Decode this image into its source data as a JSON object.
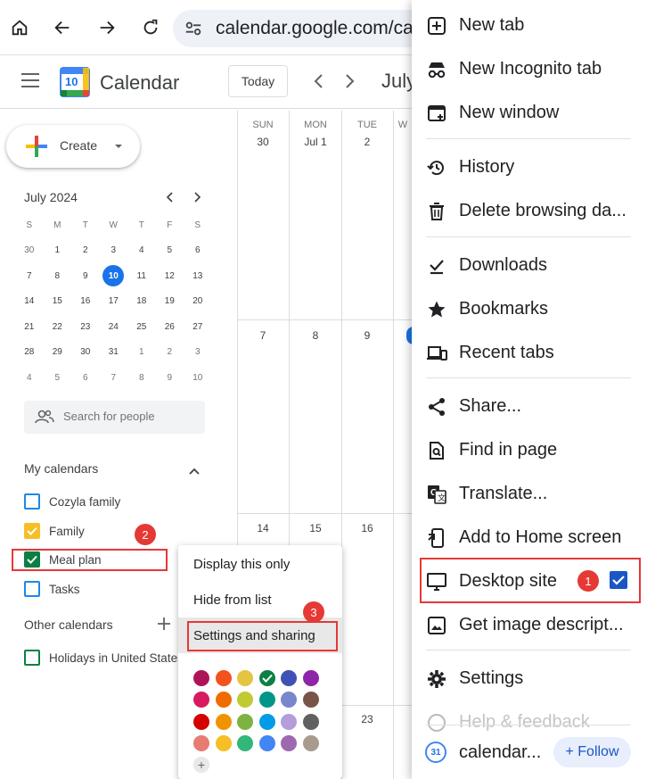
{
  "browser": {
    "url": "calendar.google.com/ca"
  },
  "header": {
    "app_title": "Calendar",
    "logo_day": "10",
    "today_label": "Today",
    "month_label": "July"
  },
  "sidebar": {
    "create_label": "Create",
    "mini_calendar": {
      "title": "July 2024",
      "weekdays": [
        "S",
        "M",
        "T",
        "W",
        "T",
        "F",
        "S"
      ],
      "weeks": [
        [
          "30",
          "1",
          "2",
          "3",
          "4",
          "5",
          "6"
        ],
        [
          "7",
          "8",
          "9",
          "10",
          "11",
          "12",
          "13"
        ],
        [
          "14",
          "15",
          "16",
          "17",
          "18",
          "19",
          "20"
        ],
        [
          "21",
          "22",
          "23",
          "24",
          "25",
          "26",
          "27"
        ],
        [
          "28",
          "29",
          "30",
          "31",
          "1",
          "2",
          "3"
        ],
        [
          "4",
          "5",
          "6",
          "7",
          "8",
          "9",
          "10"
        ]
      ]
    },
    "search_people_placeholder": "Search for people",
    "my_calendars_title": "My calendars",
    "my_calendars": [
      {
        "name": "Cozyla family",
        "color": "#1e88e5",
        "checked": false
      },
      {
        "name": "Family",
        "color": "#f6bf26",
        "checked": true
      },
      {
        "name": "Meal plan",
        "color": "#0b8043",
        "checked": true
      },
      {
        "name": "Tasks",
        "color": "#1e88e5",
        "checked": false
      }
    ],
    "other_calendars_title": "Other calendars",
    "other_calendars": [
      {
        "name": "Holidays in United States",
        "color": "#0b8043",
        "checked": false
      }
    ]
  },
  "grid": {
    "days": [
      {
        "name": "SUN",
        "date": "30"
      },
      {
        "name": "MON",
        "date": "Jul 1"
      },
      {
        "name": "TUE",
        "date": "2"
      },
      {
        "name": "W",
        "date": ""
      }
    ],
    "week2": [
      "7",
      "8",
      "9"
    ],
    "week3": [
      "14",
      "15",
      "16"
    ],
    "week4": [
      "23"
    ]
  },
  "context_menu": {
    "items": [
      "Display this only",
      "Hide from list",
      "Settings and sharing"
    ],
    "colors": [
      "#ad1457",
      "#f4511e",
      "#e4c441",
      "#0b8043",
      "#3f51b5",
      "#8e24aa",
      "#d81b60",
      "#ef6c00",
      "#c0ca33",
      "#009688",
      "#7986cb",
      "#795548",
      "#d50000",
      "#f09300",
      "#7cb342",
      "#039be5",
      "#b39ddb",
      "#616161",
      "#e67c73",
      "#f6bf26",
      "#33b679",
      "#4285f4",
      "#9e69af",
      "#a79b8e"
    ]
  },
  "chrome_menu": {
    "items": [
      {
        "label": "New tab",
        "icon": "plus-box-icon"
      },
      {
        "label": "New Incognito tab",
        "icon": "incognito-icon"
      },
      {
        "label": "New window",
        "icon": "new-window-icon"
      },
      {
        "label": "History",
        "icon": "history-icon"
      },
      {
        "label": "Delete browsing da...",
        "icon": "trash-icon"
      },
      {
        "label": "Downloads",
        "icon": "download-icon"
      },
      {
        "label": "Bookmarks",
        "icon": "star-icon"
      },
      {
        "label": "Recent tabs",
        "icon": "devices-icon"
      },
      {
        "label": "Share...",
        "icon": "share-icon"
      },
      {
        "label": "Find in page",
        "icon": "find-icon"
      },
      {
        "label": "Translate...",
        "icon": "translate-icon"
      },
      {
        "label": "Add to Home screen",
        "icon": "add-home-icon"
      },
      {
        "label": "Desktop site",
        "icon": "monitor-icon",
        "checked": true
      },
      {
        "label": "Get image descript...",
        "icon": "image-icon"
      },
      {
        "label": "Settings",
        "icon": "gear-icon"
      },
      {
        "label": "Help & feedback",
        "icon": "help-icon"
      }
    ],
    "footer_site": "calendar...",
    "follow_label": "+ Follow"
  },
  "annotations": [
    "1",
    "2",
    "3"
  ]
}
